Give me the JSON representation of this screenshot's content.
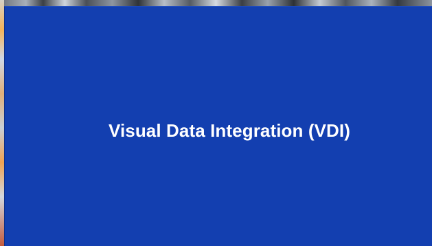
{
  "splash": {
    "title": "Visual Data Integration (VDI)"
  },
  "colors": {
    "panel_background": "#133fb0",
    "title_text": "#ffffff"
  }
}
